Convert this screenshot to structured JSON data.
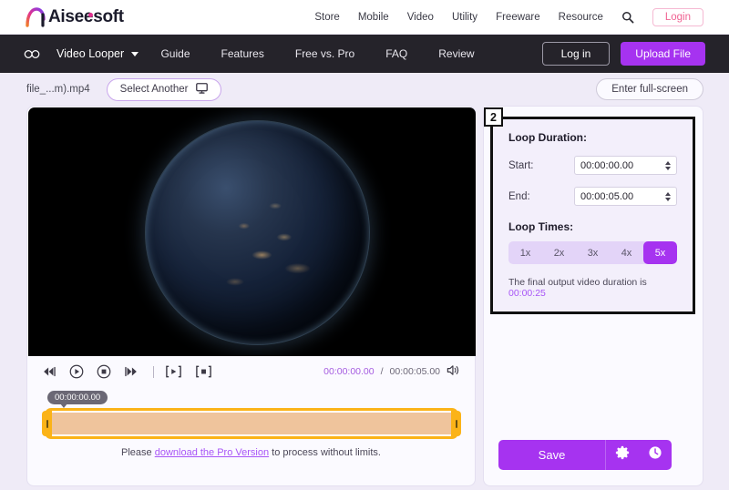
{
  "brand": {
    "name": "Aiseesoft",
    "mark_letters": "AI"
  },
  "topnav": {
    "links": [
      "Store",
      "Mobile",
      "Video",
      "Utility",
      "Freeware",
      "Resource"
    ],
    "search_icon": "search-icon",
    "login_label": "Login"
  },
  "darknav": {
    "infinity_icon": "infinity-icon",
    "product": "Video Looper",
    "caret_icon": "chevron-down-icon",
    "links": [
      "Guide",
      "Features",
      "Free vs. Pro",
      "FAQ",
      "Review"
    ],
    "login_label": "Log in",
    "upload_label": "Upload File"
  },
  "filebar": {
    "filename": "file_...m).mp4",
    "select_another_label": "Select Another",
    "monitor_icon": "monitor-icon",
    "fullscreen_label": "Enter full-screen"
  },
  "player": {
    "controls": [
      {
        "name": "rewind-icon"
      },
      {
        "name": "play-circle-icon"
      },
      {
        "name": "stop-circle-icon"
      },
      {
        "name": "fast-forward-icon"
      },
      {
        "name": "divider"
      },
      {
        "name": "set-start-bracket-icon"
      },
      {
        "name": "set-end-bracket-icon"
      }
    ],
    "current_time": "00:00:00.00",
    "separator": "/",
    "total_time": "00:00:05.00",
    "volume_icon": "volume-icon",
    "timeline_tooltip": "00:00:00.00"
  },
  "pro_note": {
    "prefix": "Please ",
    "link": "download the Pro Version",
    "suffix": " to process without limits."
  },
  "loop_panel": {
    "badge": "2",
    "title": "Loop Duration:",
    "start_label": "Start:",
    "start_value": "00:00:00.00",
    "end_label": "End:",
    "end_value": "00:00:05.00",
    "loop_times_label": "Loop Times:",
    "loop_options": [
      "1x",
      "2x",
      "3x",
      "4x",
      "5x"
    ],
    "selected_loop": "5x",
    "final_note_prefix": "The final output video duration is ",
    "final_duration": "00:00:25"
  },
  "actions": {
    "save_label": "Save",
    "settings_icon": "gear-icon",
    "history_icon": "clock-icon"
  },
  "colors": {
    "accent": "#a633f0",
    "link": "#a855f7",
    "login_pink": "#f06292",
    "timeline": "#fbb318",
    "page_bg": "#efebf7",
    "dark_nav": "#25232a"
  }
}
